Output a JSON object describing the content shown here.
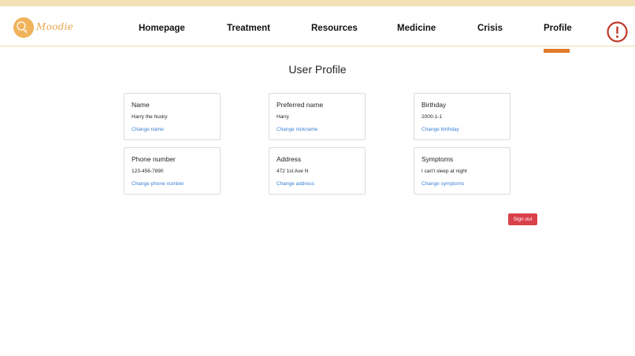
{
  "brand": {
    "name": "Moodie",
    "colors": {
      "accent": "#f0b35c",
      "strip": "#f3e2b8",
      "active": "#e07b2a",
      "alert": "#c0392b",
      "link": "#3b82d6",
      "signout": "#d9414b"
    }
  },
  "nav": {
    "items": [
      {
        "label": "Homepage"
      },
      {
        "label": "Treatment"
      },
      {
        "label": "Resources"
      },
      {
        "label": "Medicine"
      },
      {
        "label": "Crisis"
      },
      {
        "label": "Profile"
      }
    ],
    "active": "Profile",
    "alert_icon": "exclamation-circle-icon"
  },
  "page": {
    "title": "User Profile"
  },
  "cards": [
    {
      "title": "Name",
      "value": "Harry the husky",
      "link": "Change name"
    },
    {
      "title": "Preferred name",
      "value": "Harry",
      "link": "Change nickname"
    },
    {
      "title": "Birthday",
      "value": "2000-1-1",
      "link": "Change birthday"
    },
    {
      "title": "Phone number",
      "value": "123-456-7890",
      "link": "Change phone number"
    },
    {
      "title": "Address",
      "value": "472 1st Ave N",
      "link": "Change address"
    },
    {
      "title": "Symptoms",
      "value": "I can't sleep at night",
      "link": "Change symptoms"
    }
  ],
  "actions": {
    "signout_label": "Sign out"
  }
}
